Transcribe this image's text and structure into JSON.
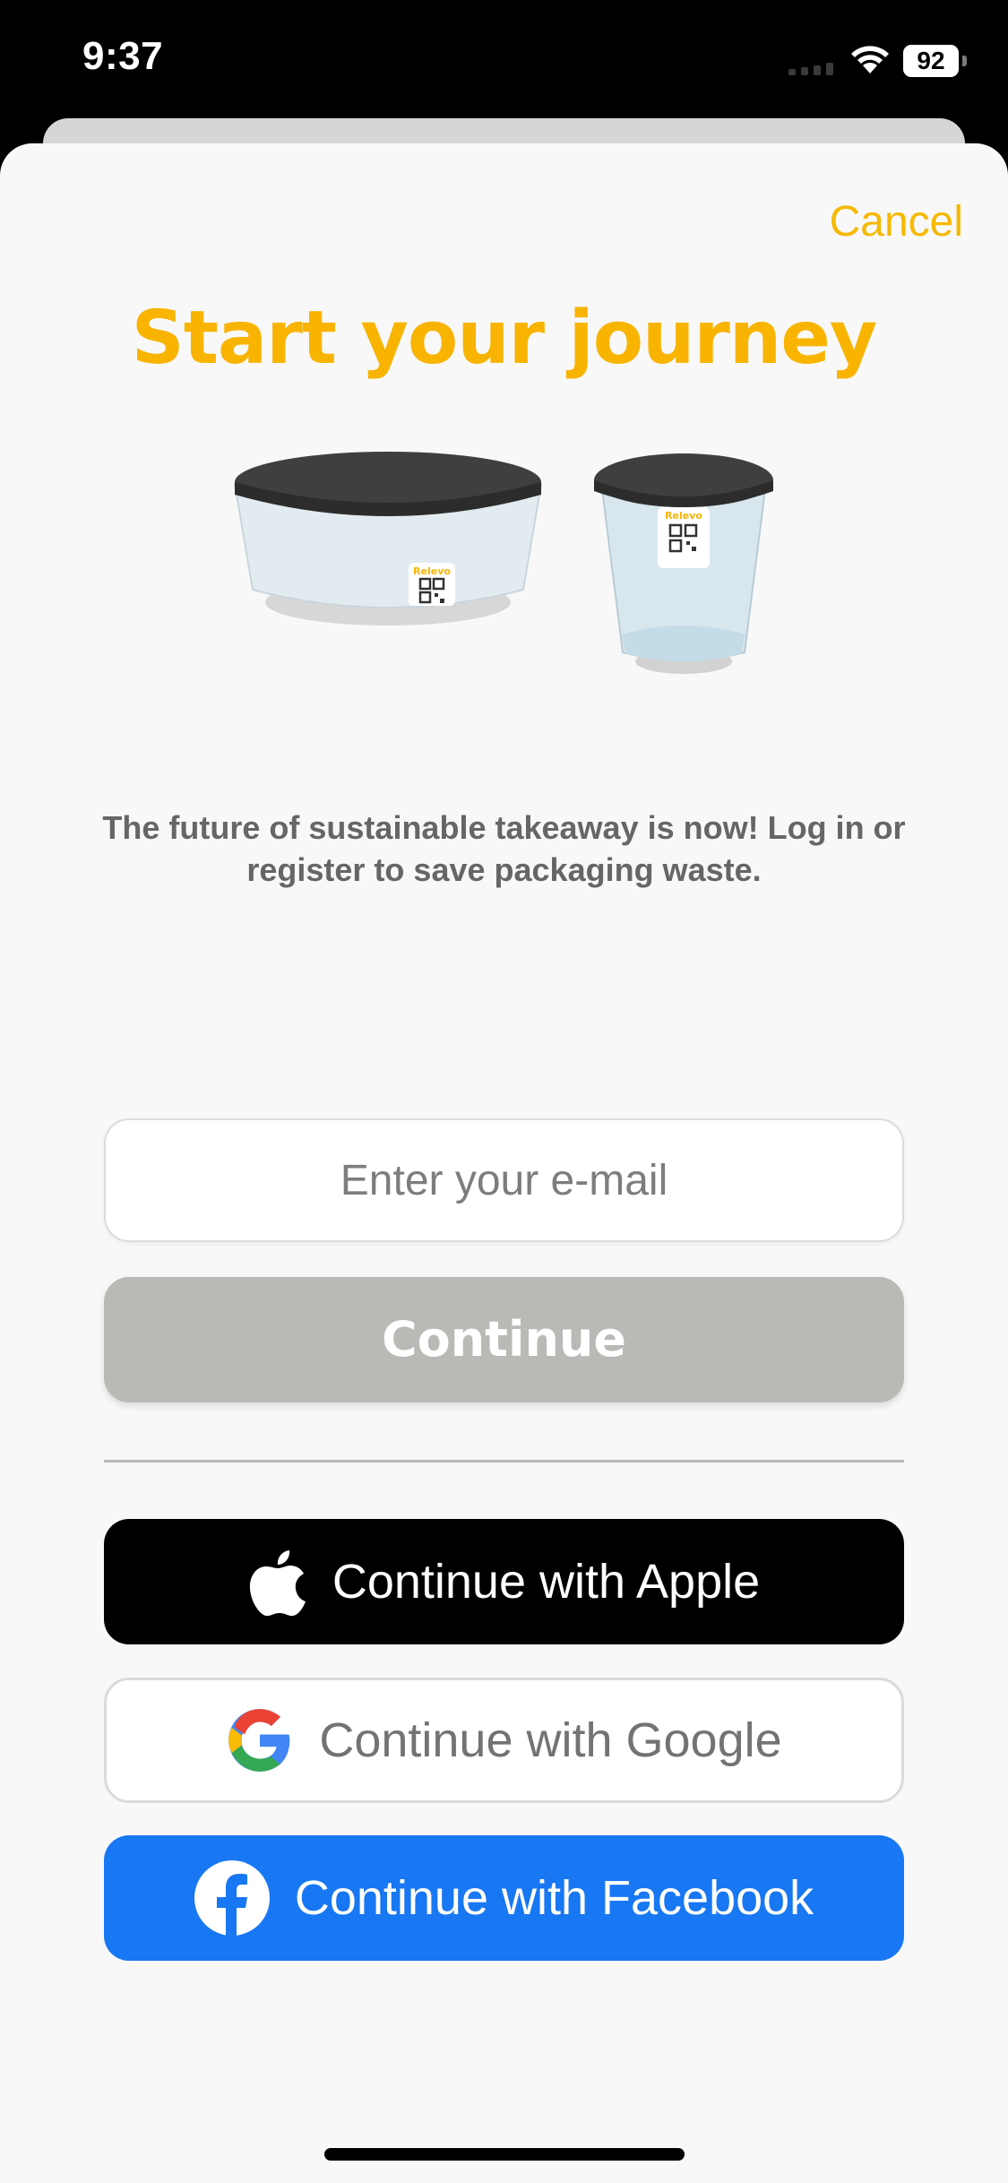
{
  "status_bar": {
    "time": "9:37",
    "battery": "92",
    "icons": [
      "signal-icon",
      "wifi-icon",
      "battery-icon"
    ]
  },
  "sheet": {
    "cancel_label": "Cancel",
    "title": "Start your journey",
    "illustration": {
      "brand_label": "Relevo",
      "items": [
        "bowl-container-icon",
        "cup-container-icon",
        "qr-code-icon"
      ]
    },
    "tagline": "The future of sustainable takeaway is now! Log in or register to save packaging waste.",
    "email": {
      "placeholder": "Enter your e-mail",
      "value": ""
    },
    "continue_label": "Continue",
    "apple_label": "Continue with Apple",
    "google_label": "Continue with Google",
    "facebook_label": "Continue with Facebook"
  },
  "colors": {
    "accent": "#f8b400",
    "continue_disabled": "#bbb9b6",
    "facebook": "#1877f2",
    "apple": "#000000",
    "background": "#f8f8f8"
  }
}
